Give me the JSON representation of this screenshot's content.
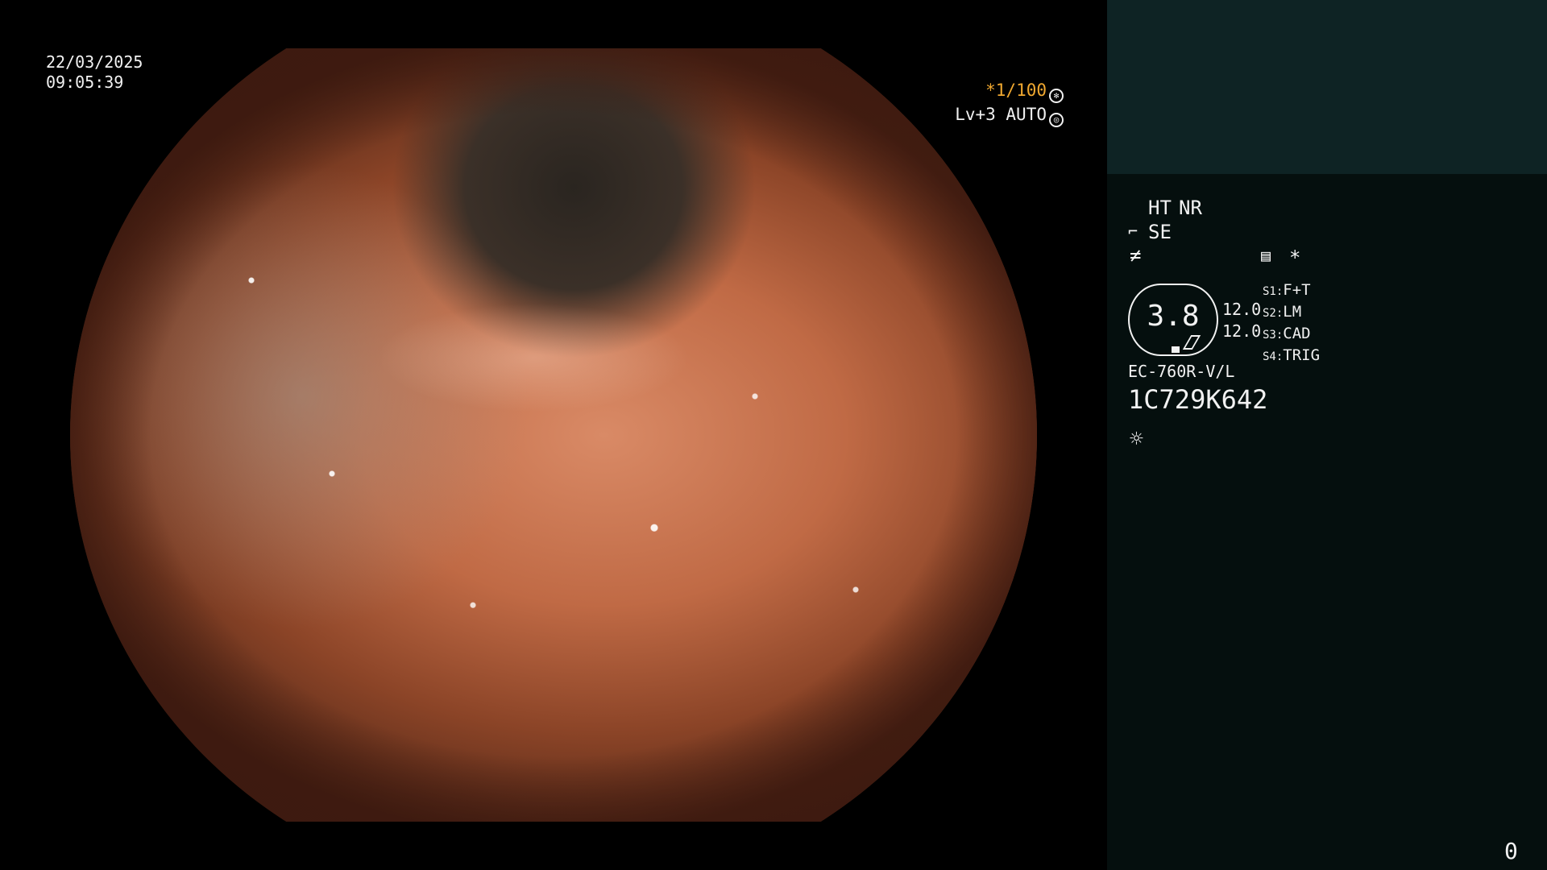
{
  "overlay": {
    "date": "22/03/2025",
    "time": "09:05:39",
    "shutter": "*1/100",
    "shutter_icon": "aperture-icon",
    "level": "Lv+3 AUTO",
    "level_icon": "auto-exposure-icon"
  },
  "panel": {
    "ht": "HT",
    "nr": "NR",
    "se": "SE",
    "se_icon": "scope-tip-icon",
    "freq_icon": "not-equal-icon",
    "settings_icon": "settings-panel-icon",
    "asterisk": "*",
    "hex_value": "3.8",
    "side_values": [
      "12.0",
      "12.0"
    ],
    "switches": [
      {
        "key": "S1:",
        "value": "F+T"
      },
      {
        "key": "S2:",
        "value": "LM"
      },
      {
        "key": "S3:",
        "value": "CAD"
      },
      {
        "key": "S4:",
        "value": "TRIG"
      }
    ],
    "model": "EC-760R-V/L",
    "serial": "1C729K642",
    "light_icon": "sun-icon",
    "counter": "0"
  },
  "colors": {
    "accent": "#f0a830",
    "panel_bg": "#050f0e",
    "panel_top": "#0e2324"
  }
}
